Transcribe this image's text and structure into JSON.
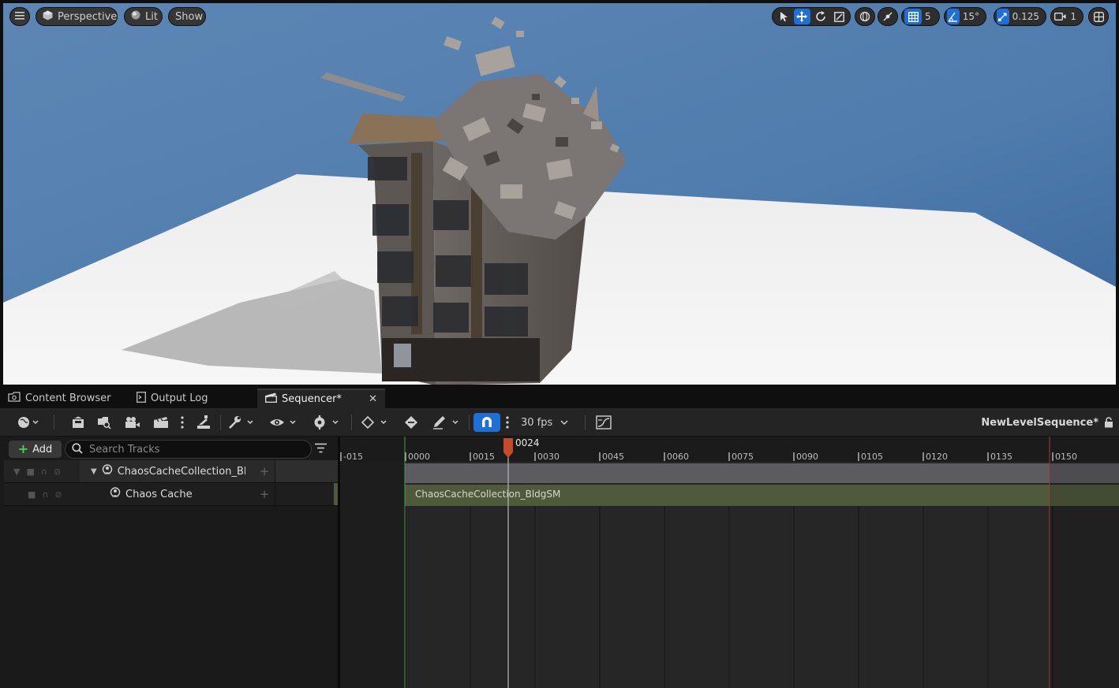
{
  "viewport": {
    "menu_icon": "hamburger-icon",
    "perspective_label": "Perspective",
    "lit_label": "Lit",
    "show_label": "Show",
    "grid_snap_value": "5",
    "rotation_snap_value": "15°",
    "scale_snap_value": "0.125",
    "camera_speed_value": "1"
  },
  "tabs": [
    {
      "label": "Content Browser"
    },
    {
      "label": "Output Log"
    },
    {
      "label": "Sequencer*"
    }
  ],
  "toolbar": {
    "fps_label": "30 fps",
    "sequence_name": "NewLevelSequence*"
  },
  "outliner": {
    "add_label": "Add",
    "search_placeholder": "Search Tracks",
    "tracks": [
      {
        "name": "ChaosCacheCollection_BldgSM"
      },
      {
        "name": "Chaos Cache"
      }
    ]
  },
  "timeline": {
    "playhead_frame": "0024",
    "ruler_labels": [
      "-015",
      "0000",
      "0015",
      "0030",
      "0045",
      "0060",
      "0075",
      "0090",
      "0105",
      "0120",
      "0135",
      "0150"
    ],
    "section_label": "ChaosCacheCollection_BldgSM"
  },
  "colors": {
    "accent": "#1e6fd6",
    "playhead": "#c24a2e",
    "start_marker": "#3fa33f",
    "end_marker": "#b33434",
    "section_green": "#4f5a3d"
  }
}
